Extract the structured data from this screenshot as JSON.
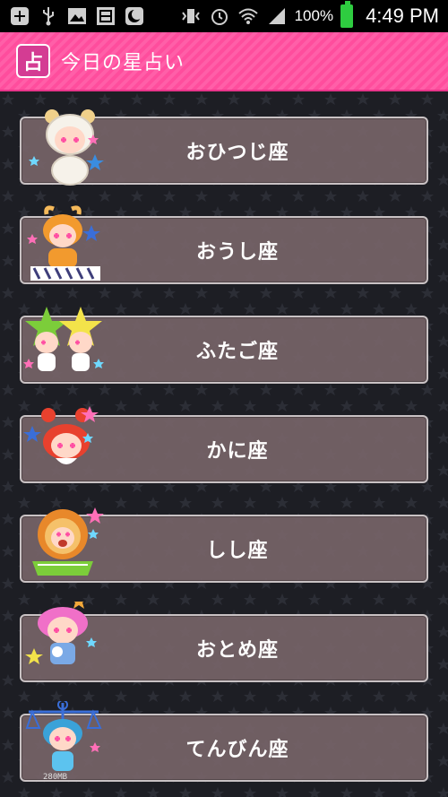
{
  "status_bar": {
    "battery_percent": "100%",
    "time": "4:49 PM",
    "icons": [
      "add-icon",
      "usb-icon",
      "image-icon",
      "download-icon",
      "moon-icon",
      "vibrate-icon",
      "alarm-icon",
      "wifi-icon",
      "signal-icon",
      "battery-icon"
    ]
  },
  "app_bar": {
    "logo_glyph": "占",
    "title": "今日の星占い",
    "color": "#ff5fa8"
  },
  "signs": [
    {
      "label": "おひつじ座",
      "mascot": "aries-mascot",
      "hair": "#f6f2ea",
      "accent": "#f0d08a"
    },
    {
      "label": "おうし座",
      "mascot": "taurus-mascot",
      "hair": "#f29a2e",
      "accent": "#f5b95a"
    },
    {
      "label": "ふたご座",
      "mascot": "gemini-mascot",
      "hair": "#7ccd3a",
      "accent": "#f3e34a"
    },
    {
      "label": "かに座",
      "mascot": "cancer-mascot",
      "hair": "#e8412e",
      "accent": "#ff6b5a"
    },
    {
      "label": "しし座",
      "mascot": "leo-mascot",
      "hair": "#e8882a",
      "accent": "#d4532a"
    },
    {
      "label": "おとめ座",
      "mascot": "virgo-mascot",
      "hair": "#f070c8",
      "accent": "#7aa9e6"
    },
    {
      "label": "てんびん座",
      "mascot": "libra-mascot",
      "hair": "#3aa2d8",
      "accent": "#5cc3ef"
    }
  ],
  "libra_badge": "280MB"
}
